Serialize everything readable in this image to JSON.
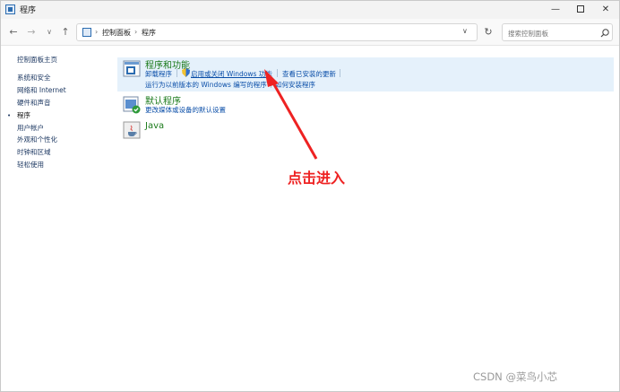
{
  "window": {
    "title": "程序"
  },
  "title_controls": {
    "minimize": "—",
    "close": "✕"
  },
  "nav": {
    "back": "←",
    "forward": "→",
    "recent": "∨",
    "up": "↑",
    "refresh": "↻"
  },
  "address": {
    "crumbs": [
      "控制面板",
      "程序"
    ],
    "separator": "›",
    "dropdown": "∨"
  },
  "search": {
    "placeholder": "搜索控制面板"
  },
  "sidebar": {
    "items": [
      {
        "label": "控制面板主页"
      },
      {
        "label": "系统和安全"
      },
      {
        "label": "网络和 Internet"
      },
      {
        "label": "硬件和声音"
      },
      {
        "label": "程序",
        "current": true
      },
      {
        "label": "用户帐户"
      },
      {
        "label": "外观和个性化"
      },
      {
        "label": "时钟和区域"
      },
      {
        "label": "轻松使用"
      }
    ],
    "bullet": "•"
  },
  "categories": [
    {
      "title": "程序和功能",
      "icon": "programs-features-icon",
      "links": [
        "卸载程序",
        "启用或关闭 Windows 功能",
        "查看已安装的更新",
        "运行为以前版本的 Windows 编写的程序",
        "如何安装程序"
      ]
    },
    {
      "title": "默认程序",
      "icon": "default-programs-icon",
      "links": [
        "更改媒体或设备的默认设置"
      ]
    },
    {
      "title": "Java",
      "icon": "java-icon",
      "links": []
    }
  ],
  "annotation": {
    "text": "点击进入",
    "color": "#ee2222"
  },
  "watermark": "CSDN @菜鸟小芯",
  "colors": {
    "accent": "#0a4ea8",
    "category_title": "#1a7a1a",
    "highlight": "#e5f1fb"
  }
}
